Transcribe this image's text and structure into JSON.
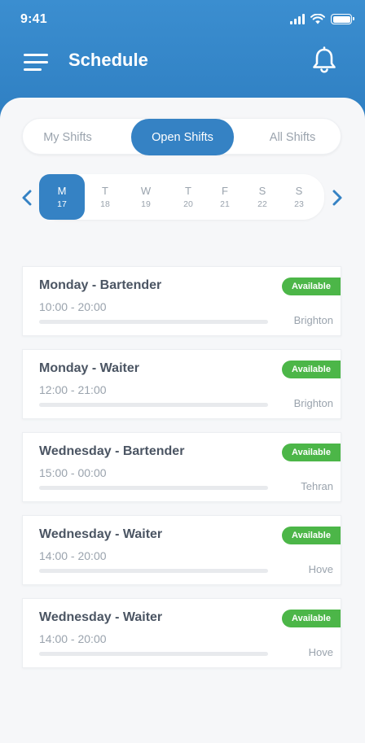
{
  "status_bar": {
    "time": "9:41"
  },
  "header": {
    "title": "Schedule"
  },
  "tabs": [
    {
      "label": "My Shifts",
      "active": false
    },
    {
      "label": "Open Shifts",
      "active": true
    },
    {
      "label": "All Shifts",
      "active": false
    }
  ],
  "days": [
    {
      "letter": "M",
      "number": "17",
      "active": true
    },
    {
      "letter": "T",
      "number": "18",
      "active": false
    },
    {
      "letter": "W",
      "number": "19",
      "active": false
    },
    {
      "letter": "T",
      "number": "20",
      "active": false
    },
    {
      "letter": "F",
      "number": "21",
      "active": false
    },
    {
      "letter": "S",
      "number": "22",
      "active": false
    },
    {
      "letter": "S",
      "number": "23",
      "active": false
    }
  ],
  "shifts": [
    {
      "title": "Monday - Bartender",
      "time": "10:00 - 20:00",
      "status": "Available",
      "location": "Brighton"
    },
    {
      "title": "Monday - Waiter",
      "time": "12:00 - 21:00",
      "status": "Available",
      "location": "Brighton"
    },
    {
      "title": "Wednesday - Bartender",
      "time": "15:00 - 00:00",
      "status": "Available",
      "location": "Tehran"
    },
    {
      "title": "Wednesday - Waiter",
      "time": "14:00 - 20:00",
      "status": "Available",
      "location": "Hove"
    },
    {
      "title": "Wednesday - Waiter",
      "time": "14:00 - 20:00",
      "status": "Available",
      "location": "Hove"
    }
  ],
  "colors": {
    "primary": "#3582c4",
    "available": "#4cb648",
    "muted_text": "#9aa3ad",
    "title_text": "#4b5563"
  },
  "icons": {
    "menu": "hamburger-menu-icon",
    "notifications": "bell-icon",
    "prev": "chevron-left-icon",
    "next": "chevron-right-icon"
  }
}
